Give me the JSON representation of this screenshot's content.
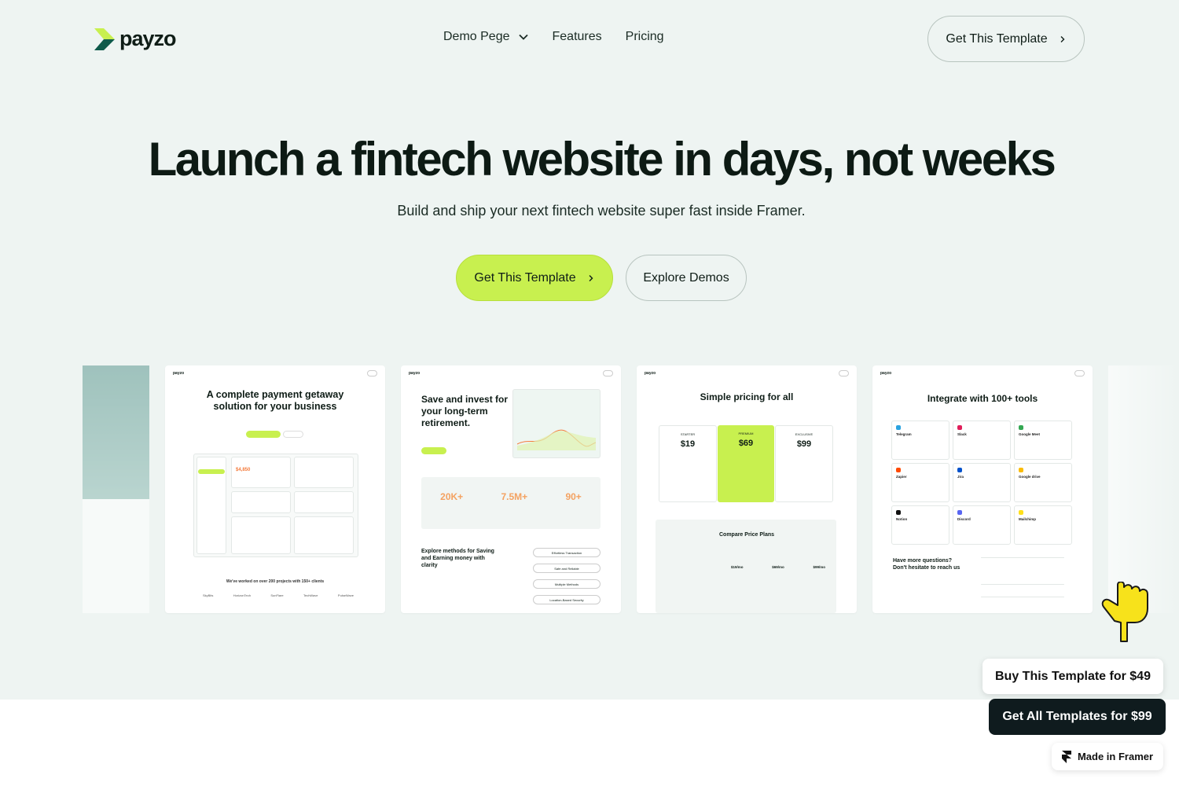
{
  "brand": {
    "name": "payzo",
    "accent": "#c8f04f",
    "dark": "#0f1b1e"
  },
  "nav": {
    "items": [
      {
        "label": "Demo Pege",
        "icon": "chevron-down-icon"
      },
      {
        "label": "Features"
      },
      {
        "label": "Pricing"
      }
    ],
    "cta_label": "Get This Template"
  },
  "hero": {
    "headline": "Launch a fintech website in days, not weeks",
    "subline": "Build and ship your next fintech website super fast inside Framer.",
    "primary_cta": "Get This Template",
    "secondary_cta": "Explore Demos"
  },
  "cards": [
    {
      "title": "A complete payment getaway solution for your business",
      "footer": "We've worked on over 200 projects with 150+ clients",
      "clients": [
        "SkyBits",
        "HorizonTech",
        "SunFlare",
        "TechWave",
        "PulseWave"
      ],
      "balance": "$4,850"
    },
    {
      "title": "Save and invest for your long-term retirement.",
      "stats": [
        "20K+",
        "7.5M+",
        "90+"
      ],
      "section": "Explore methods for Saving and Earning money with clarity",
      "methods": [
        "Effortless Transaction",
        "Safe and Reliable",
        "Multiple Methods",
        "Location-Based Security"
      ]
    },
    {
      "title": "Simple pricing for all",
      "plans": [
        {
          "name": "STARTER",
          "price": "$19"
        },
        {
          "name": "PREMIUM",
          "price": "$69"
        },
        {
          "name": "EXCLUSIVE",
          "price": "$99"
        }
      ],
      "compare_title": "Compare Price Plans",
      "compare_prices": [
        "$19/mo",
        "$69/mo",
        "$99/mo"
      ]
    },
    {
      "title": "Integrate with 100+ tools",
      "tools": [
        "Telegram",
        "Slack",
        "Google Meet",
        "Zapier",
        "Jira",
        "Google drive",
        "Notion",
        "Discord",
        "Mailchimp"
      ],
      "faq_title": "Have more questions? Don't hesitate to reach us"
    }
  ],
  "floating": {
    "buy_label": "Buy This Template for $49",
    "all_label": "Get All Templates for $99",
    "framer_label": "Made in Framer"
  }
}
